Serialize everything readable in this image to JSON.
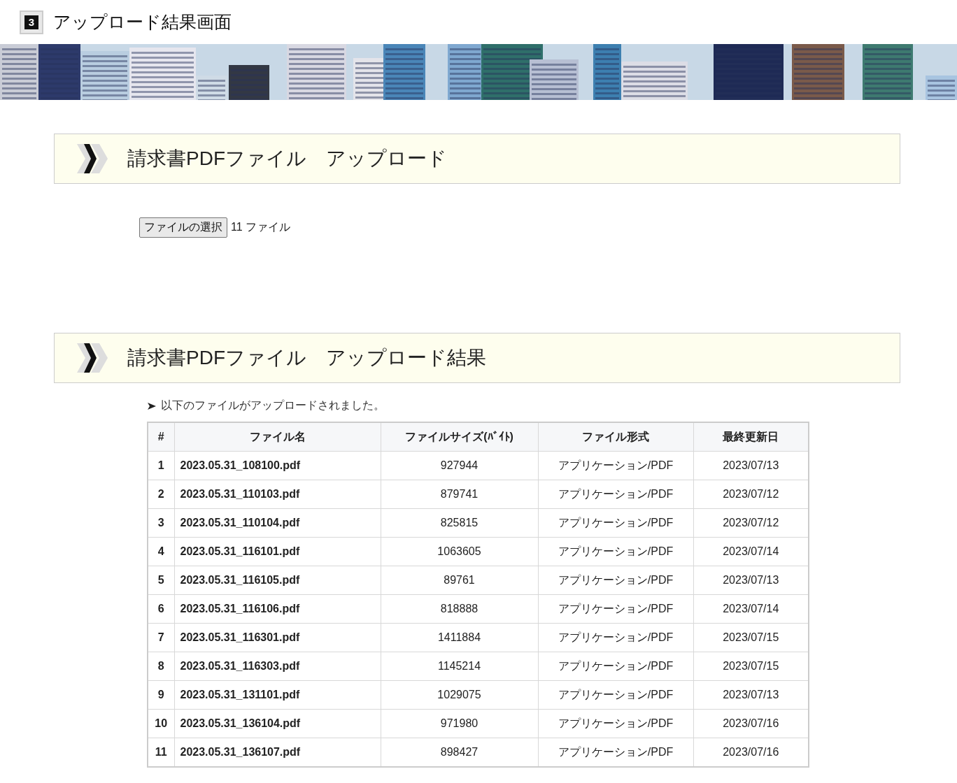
{
  "page_title": {
    "number": "3",
    "text": "アップロード結果画面"
  },
  "upload_section": {
    "heading": "請求書PDFファイル　アップロード",
    "file_button": "ファイルの選択",
    "file_status": "11 ファイル"
  },
  "result_section": {
    "heading": "請求書PDFファイル　アップロード結果",
    "message": "以下のファイルがアップロードされました。",
    "table": {
      "columns": [
        "#",
        "ファイル名",
        "ファイルサイズ(ﾊﾞｲﾄ)",
        "ファイル形式",
        "最終更新日"
      ],
      "rows": [
        [
          "1",
          "2023.05.31_108100.pdf",
          "927944",
          "アプリケーション/PDF",
          "2023/07/13"
        ],
        [
          "2",
          "2023.05.31_110103.pdf",
          "879741",
          "アプリケーション/PDF",
          "2023/07/12"
        ],
        [
          "3",
          "2023.05.31_110104.pdf",
          "825815",
          "アプリケーション/PDF",
          "2023/07/12"
        ],
        [
          "4",
          "2023.05.31_116101.pdf",
          "1063605",
          "アプリケーション/PDF",
          "2023/07/14"
        ],
        [
          "5",
          "2023.05.31_116105.pdf",
          "89761",
          "アプリケーション/PDF",
          "2023/07/13"
        ],
        [
          "6",
          "2023.05.31_116106.pdf",
          "818888",
          "アプリケーション/PDF",
          "2023/07/14"
        ],
        [
          "7",
          "2023.05.31_116301.pdf",
          "1411884",
          "アプリケーション/PDF",
          "2023/07/15"
        ],
        [
          "8",
          "2023.05.31_116303.pdf",
          "1145214",
          "アプリケーション/PDF",
          "2023/07/15"
        ],
        [
          "9",
          "2023.05.31_131101.pdf",
          "1029075",
          "アプリケーション/PDF",
          "2023/07/13"
        ],
        [
          "10",
          "2023.05.31_136104.pdf",
          "971980",
          "アプリケーション/PDF",
          "2023/07/16"
        ],
        [
          "11",
          "2023.05.31_136107.pdf",
          "898427",
          "アプリケーション/PDF",
          "2023/07/16"
        ]
      ]
    }
  }
}
